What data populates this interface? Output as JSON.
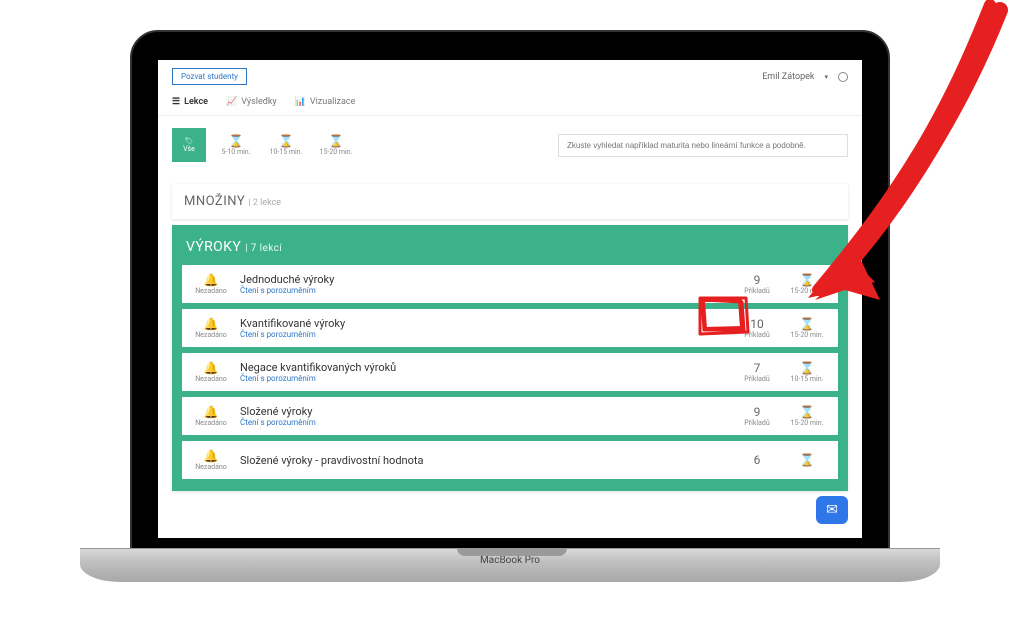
{
  "topbar": {
    "invite_label": "Pozvat studenty",
    "user_name": "Emil Zátopek"
  },
  "tabs": {
    "lekce": "Lekce",
    "vysledky": "Výsledky",
    "vizualizace": "Vizualizace"
  },
  "filters": {
    "all": "Vše",
    "f1": "5-10 min.",
    "f2": "10-15 min.",
    "f3": "15-20 min."
  },
  "search": {
    "placeholder": "Zkuste vyhledat například maturita nebo lineární funkce a podobně."
  },
  "section_mnoziny": {
    "title": "MNOŽINY",
    "count": "| 2 lekce"
  },
  "section_vyroky": {
    "title": "VÝROKY",
    "count": "| 7 lekcí"
  },
  "bell_label": "Nezadáno",
  "count_label": "Příkladů",
  "lessons": [
    {
      "title": "Jednoduché výroky",
      "sub": "Čtení s porozuměním",
      "count": "9",
      "time": "15-20 min."
    },
    {
      "title": "Kvantifikované výroky",
      "sub": "Čtení s porozuměním",
      "count": "10",
      "time": "15-20 min."
    },
    {
      "title": "Negace kvantifikovaných výroků",
      "sub": "Čtení s porozuměním",
      "count": "7",
      "time": "10-15 min."
    },
    {
      "title": "Složené výroky",
      "sub": "Čtení s porozuměním",
      "count": "9",
      "time": "15-20 min."
    },
    {
      "title": "Složené výroky - pravdivostní hodnota",
      "sub": "",
      "count": "6",
      "time": ""
    }
  ],
  "laptop_label": "MacBook Pro"
}
